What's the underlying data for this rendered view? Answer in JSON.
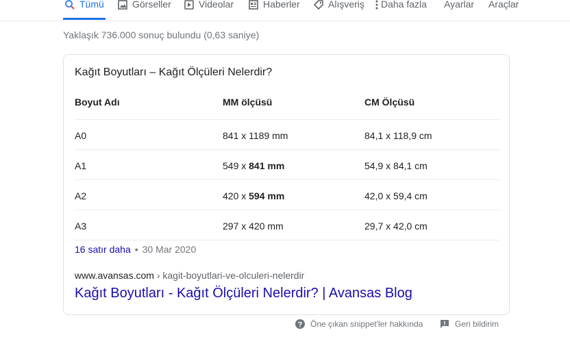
{
  "tabs": [
    {
      "label": "Tümü",
      "icon": "search-icon",
      "active": true
    },
    {
      "label": "Görseller",
      "icon": "image-icon"
    },
    {
      "label": "Videolar",
      "icon": "video-icon"
    },
    {
      "label": "Haberler",
      "icon": "news-icon"
    },
    {
      "label": "Alışveriş",
      "icon": "tag-icon"
    },
    {
      "label": "Daha fazla",
      "icon": "more-vert-icon"
    },
    {
      "label": "Ayarlar"
    },
    {
      "label": "Araçlar"
    }
  ],
  "result_stats": "Yaklaşık 736.000 sonuç bulundu (0,63 saniye)",
  "snippet": {
    "title": "Kağıt Boyutları – Kağıt Ölçüleri Nelerdir?",
    "table": {
      "headers": [
        "Boyut Adı",
        "MM ölçüsü",
        "CM Ölçüsü"
      ],
      "rows": [
        {
          "name": "A0",
          "mm": "841 x 1189 mm",
          "cm": "84,1 x 118,9 cm"
        },
        {
          "name": "A1",
          "mm_prefix": "549 x ",
          "mm_bold": "841 mm",
          "cm": "54,9 x 84,1 cm"
        },
        {
          "name": "A2",
          "mm_prefix": "420 x ",
          "mm_bold": "594 mm",
          "cm": "42,0 x 59,4 cm"
        },
        {
          "name": "A3",
          "mm": "297 x 420 mm",
          "cm": "29,7 x 42,0 cm"
        }
      ]
    },
    "more_rows": "16 satır daha",
    "separator": "•",
    "date": "30 Mar 2020",
    "cite_domain": "www.avansas.com",
    "cite_path": " › kagit-boyutlari-ve-olculeri-nelerdir",
    "result_title": "Kağıt Boyutları - Kağıt Ölçüleri Nelerdir? | Avansas Blog"
  },
  "footer": {
    "about_snippets": "Öne çıkan snippet'ler hakkında",
    "feedback": "Geri bildirim"
  },
  "colors": {
    "accent": "#1a73e8",
    "link": "#1a0dab",
    "muted": "#70757a"
  }
}
